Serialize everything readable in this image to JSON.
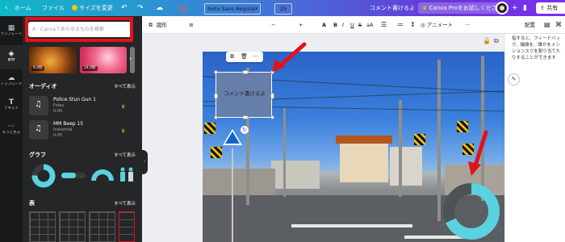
{
  "topbar": {
    "home": "ホーム",
    "file": "ファイル",
    "resize": "サイズを変更",
    "undo_icon": "undo-icon",
    "redo_icon": "redo-icon",
    "cloud_icon": "cloud-save-icon",
    "comment_notice": "コメント書けるよ",
    "try_pro": "Canva Proをお試しください",
    "share": "共有"
  },
  "rail": {
    "items": [
      {
        "icon": "template-icon",
        "label": "テンプレート"
      },
      {
        "icon": "elements-icon",
        "label": "素材"
      },
      {
        "icon": "upload-icon",
        "label": "アップロード"
      },
      {
        "icon": "text-icon",
        "label": "テキスト"
      },
      {
        "icon": "more-icon",
        "label": "もっと見る"
      }
    ]
  },
  "panel": {
    "search_placeholder": "Canvaであらゆるものを検索",
    "videos": [
      {
        "duration": "6.0秒"
      },
      {
        "duration": "24.0秒"
      }
    ],
    "audio_title": "オーディオ",
    "show_all": "すべて表示",
    "audio": [
      {
        "title": "Police Stun Gun 1",
        "genre": "Foley",
        "duration": "0:05"
      },
      {
        "title": "MM Beep 15",
        "genre": "Industrial",
        "duration": "0:05"
      }
    ],
    "graph_title": "グラフ",
    "table_title": "表"
  },
  "toolbar": {
    "effects": "図形",
    "font": "Noto Sans Regular",
    "font_size": "25",
    "bold": "B",
    "italic": "I",
    "underline": "U",
    "case": "aA",
    "animate": "アニメート",
    "position": "配置"
  },
  "comment_pane": {
    "text": "指すると、フィードバック、議論を、誰かをメンションスクを割り当てたりすることができます"
  },
  "canvas": {
    "textbox_text": "コメント書けるよ",
    "accent_color": "#667eaa",
    "donut_color": "#5ad2e0",
    "highlight_color": "#e1121b"
  }
}
